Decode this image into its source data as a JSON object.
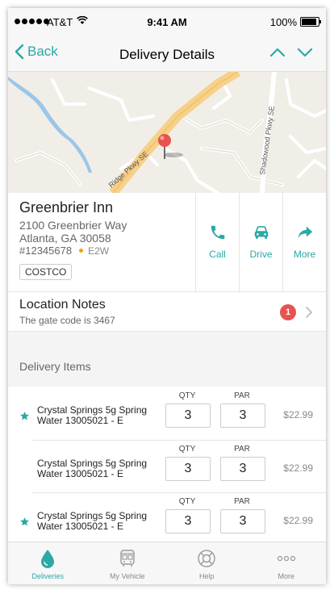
{
  "status_bar": {
    "carrier": "AT&T",
    "time": "9:41 AM",
    "battery": "100%"
  },
  "nav": {
    "back_label": "Back",
    "title": "Delivery Details",
    "icons": [
      "chevron-left-icon",
      "chevron-up-icon",
      "chevron-down-icon"
    ]
  },
  "map": {
    "street_labels": [
      "Ridge Pkwy SE",
      "Shadowood Pkwy SE"
    ]
  },
  "location": {
    "name": "Greenbrier Inn",
    "address_line1": "2100 Greenbrier Way",
    "address_line2": "Atlanta, GA 30058",
    "account_number": "#12345678",
    "route": "E2W",
    "tag": "COSTCO"
  },
  "actions": [
    {
      "label": "Call",
      "icon": "phone-icon"
    },
    {
      "label": "Drive",
      "icon": "car-icon"
    },
    {
      "label": "More",
      "icon": "share-arrow-icon"
    }
  ],
  "notes": {
    "title": "Location Notes",
    "subtitle": "The gate code is 3467",
    "badge_count": "1"
  },
  "items_section": {
    "header": "Delivery Items",
    "qty_label": "QTY",
    "par_label": "PAR",
    "items": [
      {
        "name": "Crystal Springs 5g Spring Water 13005021 - E",
        "qty": "3",
        "par": "3",
        "price": "$22.99",
        "starred": true
      },
      {
        "name": "Crystal Springs 5g Spring Water 13005021 - E",
        "qty": "3",
        "par": "3",
        "price": "$22.99",
        "starred": false
      },
      {
        "name": "Crystal Springs 5g Spring Water 13005021 - E",
        "qty": "3",
        "par": "3",
        "price": "$22.99",
        "starred": true
      }
    ]
  },
  "tabs": [
    {
      "label": "Deliveries",
      "icon": "water-drop-icon",
      "active": true
    },
    {
      "label": "My Vehicle",
      "icon": "bus-icon",
      "active": false
    },
    {
      "label": "Help",
      "icon": "lifebuoy-icon",
      "active": false
    },
    {
      "label": "More",
      "icon": "ellipsis-icon",
      "active": false
    }
  ],
  "colors": {
    "accent": "#2aa9a6",
    "badge": "#e8524f",
    "route_dot": "#f0a500",
    "road": "#f7d089"
  }
}
